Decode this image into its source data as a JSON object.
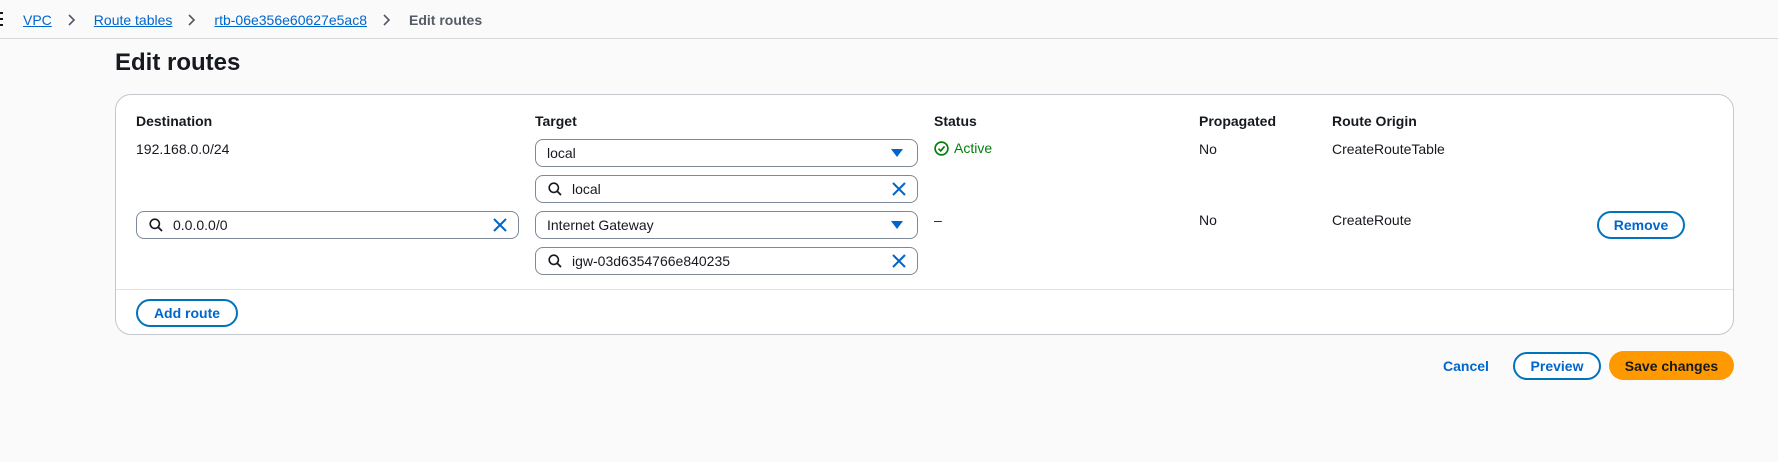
{
  "breadcrumb": {
    "items": [
      "VPC",
      "Route tables",
      "rtb-06e356e60627e5ac8"
    ],
    "current": "Edit routes"
  },
  "page_title": "Edit routes",
  "table": {
    "columns": [
      "Destination",
      "Target",
      "Status",
      "Propagated",
      "Route Origin"
    ],
    "rows": [
      {
        "destination": "192.168.0.0/24",
        "target_type": "local",
        "target_search": "local",
        "status": "Active",
        "propagated": "No",
        "route_origin": "CreateRouteTable"
      },
      {
        "destination": "0.0.0.0/0",
        "target_type": "Internet Gateway",
        "target_search": "igw-03d6354766e840235",
        "status": "–",
        "propagated": "No",
        "route_origin": "CreateRoute",
        "remove_label": "Remove"
      }
    ]
  },
  "add_route_label": "Add route",
  "actions": {
    "cancel": "Cancel",
    "preview": "Preview",
    "save": "Save changes"
  },
  "colors": {
    "link": "#0066cc",
    "primary": "#ff9900",
    "success": "#037f0c"
  },
  "icons": [
    "menu-icon",
    "chevron-right-icon",
    "caret-down-icon",
    "search-icon",
    "clear-icon",
    "check-circle-icon"
  ]
}
